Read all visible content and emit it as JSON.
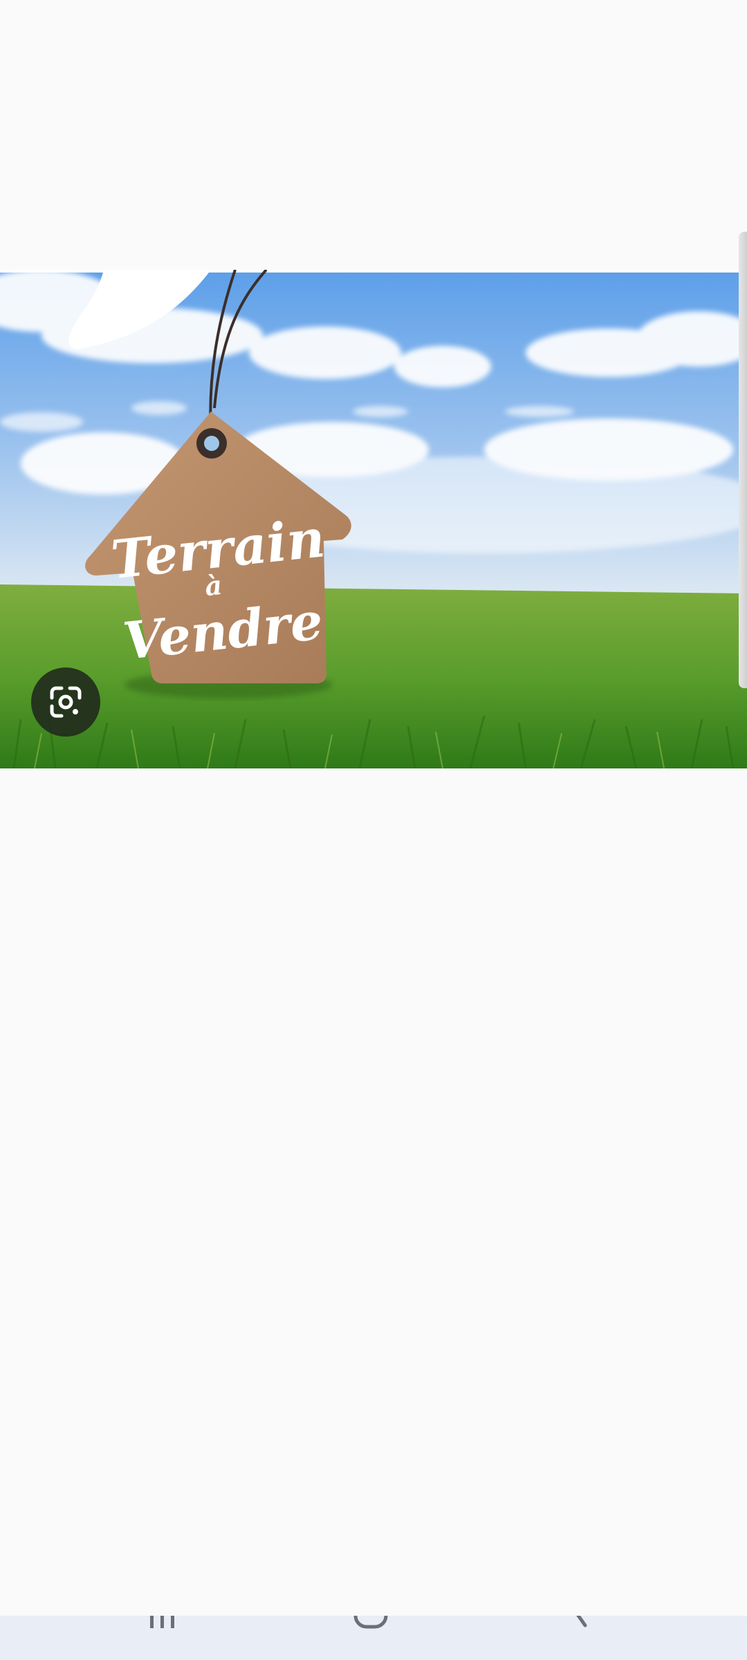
{
  "screen": {
    "background": "#fafafa",
    "nav_bar_color": "#e9edf5"
  },
  "image": {
    "tag_text_line1": "Terrain",
    "tag_text_line2": "à",
    "tag_text_line3": "Vendre",
    "sky_color": "#6fa8ea",
    "grass_color": "#4f9a2a",
    "tag_color": "#b98c67"
  },
  "lens_button": {
    "icon": "google-lens-icon"
  },
  "nav": {
    "recents_icon": "recents-icon",
    "home_icon": "home-icon",
    "back_icon": "back-icon"
  }
}
